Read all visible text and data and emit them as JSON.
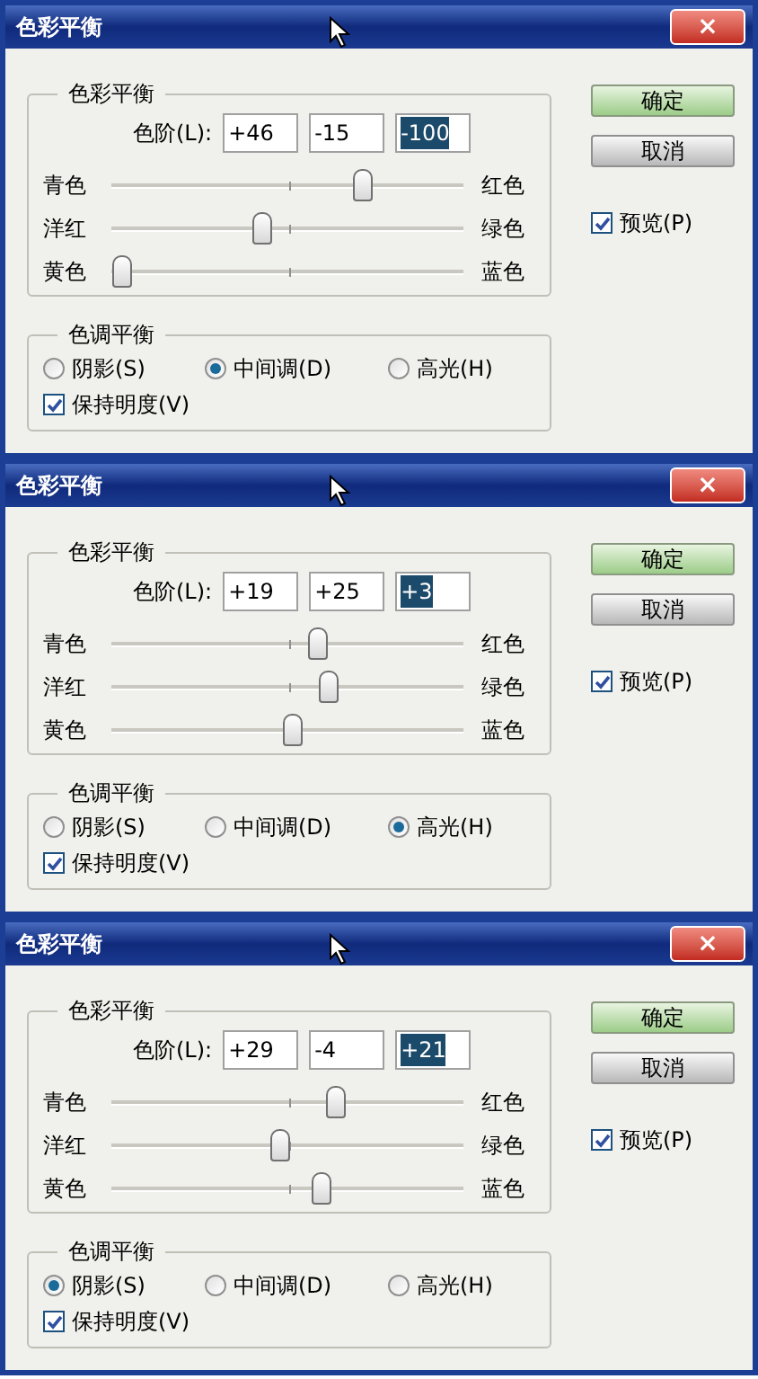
{
  "dialogs": [
    {
      "title": "色彩平衡",
      "close": "×",
      "color_balance": {
        "legend": "色彩平衡",
        "levels_label": "色阶(L):",
        "fields": [
          {
            "value": "+46",
            "selected": false
          },
          {
            "value": "-15",
            "selected": false
          },
          {
            "value": "-100",
            "selected": true
          }
        ],
        "sliders": [
          {
            "left": "青色",
            "right": "红色",
            "level": 0.73
          },
          {
            "left": "洋红",
            "right": "绿色",
            "level": 0.425
          },
          {
            "left": "黄色",
            "right": "蓝色",
            "level": 0
          }
        ]
      },
      "tone_balance": {
        "legend": "色调平衡",
        "options": [
          {
            "label": "阴影(S)",
            "selected": false
          },
          {
            "label": "中间调(D)",
            "selected": true
          },
          {
            "label": "高光(H)",
            "selected": false
          }
        ],
        "preserve": {
          "label": "保持明度(V)",
          "checked": true
        }
      },
      "buttons": [
        "确定",
        "取消"
      ],
      "preview": {
        "label": "预览(P)",
        "checked": true
      }
    },
    {
      "title": "色彩平衡",
      "close": "×",
      "color_balance": {
        "legend": "色彩平衡",
        "levels_label": "色阶(L):",
        "fields": [
          {
            "value": "+19",
            "selected": false
          },
          {
            "value": "+25",
            "selected": false
          },
          {
            "value": "+3",
            "selected": true
          }
        ],
        "sliders": [
          {
            "left": "青色",
            "right": "红色",
            "level": 0.595
          },
          {
            "left": "洋红",
            "right": "绿色",
            "level": 0.625
          },
          {
            "left": "黄色",
            "right": "蓝色",
            "level": 0.515
          }
        ]
      },
      "tone_balance": {
        "legend": "色调平衡",
        "options": [
          {
            "label": "阴影(S)",
            "selected": false
          },
          {
            "label": "中间调(D)",
            "selected": false
          },
          {
            "label": "高光(H)",
            "selected": true
          }
        ],
        "preserve": {
          "label": "保持明度(V)",
          "checked": true
        }
      },
      "buttons": [
        "确定",
        "取消"
      ],
      "preview": {
        "label": "预览(P)",
        "checked": true
      }
    },
    {
      "title": "色彩平衡",
      "close": "×",
      "color_balance": {
        "legend": "色彩平衡",
        "levels_label": "色阶(L):",
        "fields": [
          {
            "value": "+29",
            "selected": false
          },
          {
            "value": "-4",
            "selected": false
          },
          {
            "value": "+21",
            "selected": true
          }
        ],
        "sliders": [
          {
            "left": "青色",
            "right": "红色",
            "level": 0.645
          },
          {
            "left": "洋红",
            "right": "绿色",
            "level": 0.48
          },
          {
            "left": "黄色",
            "right": "蓝色",
            "level": 0.605
          }
        ]
      },
      "tone_balance": {
        "legend": "色调平衡",
        "options": [
          {
            "label": "阴影(S)",
            "selected": true
          },
          {
            "label": "中间调(D)",
            "selected": false
          },
          {
            "label": "高光(H)",
            "selected": false
          }
        ],
        "preserve": {
          "label": "保持明度(V)",
          "checked": true
        }
      },
      "buttons": [
        "确定",
        "取消"
      ],
      "preview": {
        "label": "预览(P)",
        "checked": true
      }
    }
  ]
}
